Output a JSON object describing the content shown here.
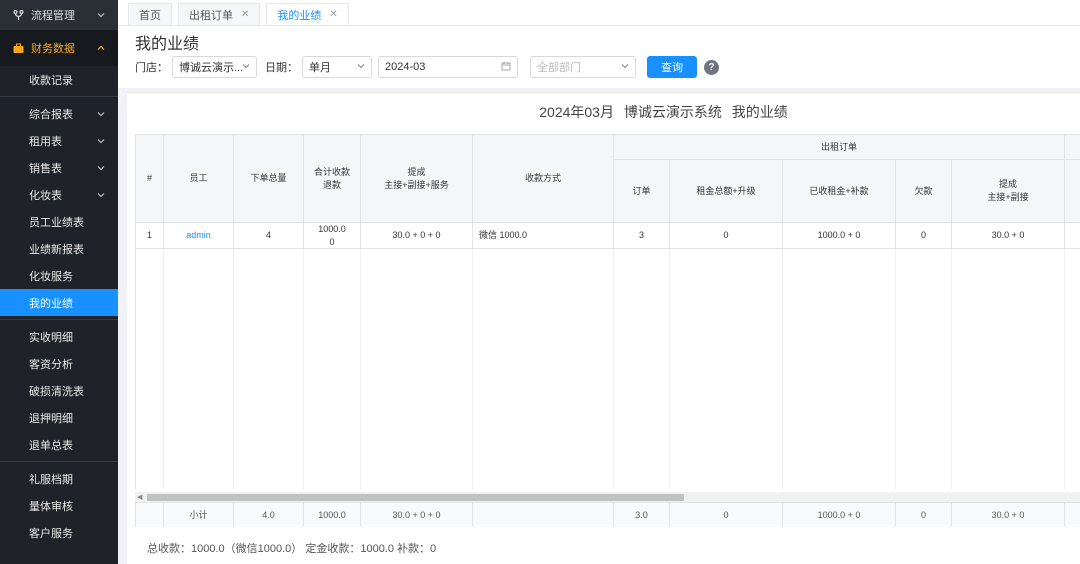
{
  "sidebar": {
    "top_group": {
      "label": "流程管理"
    },
    "open_group": {
      "label": "财务数据"
    },
    "items": [
      {
        "label": "收款记录",
        "expandable": false,
        "active": false
      },
      {
        "label": "综合报表",
        "expandable": true,
        "active": false
      },
      {
        "label": "租用表",
        "expandable": true,
        "active": false
      },
      {
        "label": "销售表",
        "expandable": true,
        "active": false
      },
      {
        "label": "化妆表",
        "expandable": true,
        "active": false
      },
      {
        "label": "员工业绩表",
        "expandable": false,
        "active": false
      },
      {
        "label": "业绩新报表",
        "expandable": false,
        "active": false
      },
      {
        "label": "化妆服务",
        "expandable": false,
        "active": false
      },
      {
        "label": "我的业绩",
        "expandable": false,
        "active": true
      },
      {
        "label": "实收明细",
        "expandable": false,
        "active": false
      },
      {
        "label": "客资分析",
        "expandable": false,
        "active": false
      },
      {
        "label": "破损清洗表",
        "expandable": false,
        "active": false
      },
      {
        "label": "退押明细",
        "expandable": false,
        "active": false
      },
      {
        "label": "退单总表",
        "expandable": false,
        "active": false
      },
      {
        "label": "礼服档期",
        "expandable": false,
        "active": false
      },
      {
        "label": "量体审核",
        "expandable": false,
        "active": false
      },
      {
        "label": "客户服务",
        "expandable": false,
        "active": false
      }
    ]
  },
  "tabs": [
    {
      "label": "首页",
      "closable": false,
      "active": false
    },
    {
      "label": "出租订单",
      "closable": true,
      "active": false
    },
    {
      "label": "我的业绩",
      "closable": true,
      "active": true
    }
  ],
  "page_title": "我的业绩",
  "filters": {
    "store_label": "门店：",
    "store_value": "博诚云演示...",
    "date_label": "日期：",
    "date_mode": "单月",
    "month": "2024-03",
    "dept_placeholder": "全部部门",
    "query_label": "查询",
    "help_glyph": "?"
  },
  "report": {
    "title": "2024年03月 博诚云演示系统 我的业绩",
    "group_header": "出租订单",
    "columns": {
      "idx": "#",
      "employee": "员工",
      "order_total": "下单总量",
      "received": "合计收款\n退款",
      "commission": "提成\n主接+副接+服务",
      "payment_method": "收款方式",
      "orders": "订单",
      "rent_total": "租金总额+升级",
      "rent_received": "已收租金+补款",
      "owed": "欠款",
      "commission2": "提成\n主接+副接"
    },
    "rows": [
      {
        "idx": "1",
        "employee": "admin",
        "order_total": "4",
        "received": "1000.0\n0",
        "commission": "30.0 + 0 + 0",
        "payment_method": "微信 1000.0",
        "orders": "3",
        "rent_total": "0",
        "rent_received": "1000.0 + 0",
        "owed": "0",
        "commission2": "30.0 + 0"
      }
    ],
    "subtotal": {
      "label": "小计",
      "order_total": "4.0",
      "received": "1000.0",
      "commission": "30.0 + 0 + 0",
      "orders": "3.0",
      "rent_total": "0",
      "rent_received": "1000.0 + 0",
      "owed": "0",
      "commission2": "30.0 + 0"
    },
    "summary": "总收款：1000.0（微信1000.0） 定金收款：1000.0 补款：0"
  }
}
